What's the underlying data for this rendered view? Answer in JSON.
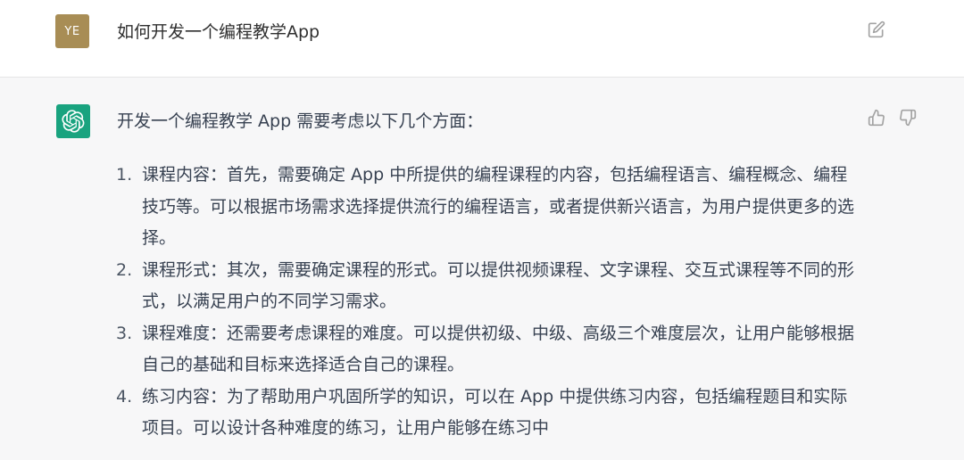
{
  "user": {
    "avatar_initials": "YE",
    "avatar_color": "#a88d55",
    "message": "如何开发一个编程教学App",
    "edit_icon": "edit-icon"
  },
  "assistant": {
    "avatar_color": "#19a37f",
    "avatar_icon": "openai-logo-icon",
    "intro": "开发一个编程教学 App 需要考虑以下几个方面：",
    "thumbs_up_icon": "thumbs-up-icon",
    "thumbs_down_icon": "thumbs-down-icon",
    "points": [
      {
        "num": "1.",
        "text": "课程内容：首先，需要确定 App 中所提供的编程课程的内容，包括编程语言、编程概念、编程技巧等。可以根据市场需求选择提供流行的编程语言，或者提供新兴语言，为用户提供更多的选择。"
      },
      {
        "num": "2.",
        "text": "课程形式：其次，需要确定课程的形式。可以提供视频课程、文字课程、交互式课程等不同的形式，以满足用户的不同学习需求。"
      },
      {
        "num": "3.",
        "text": "课程难度：还需要考虑课程的难度。可以提供初级、中级、高级三个难度层次，让用户能够根据自己的基础和目标来选择适合自己的课程。"
      },
      {
        "num": "4.",
        "text": "练习内容：为了帮助用户巩固所学的知识，可以在 App 中提供练习内容，包括编程题目和实际项目。可以设计各种难度的练习，让用户能够在练习中"
      }
    ]
  }
}
